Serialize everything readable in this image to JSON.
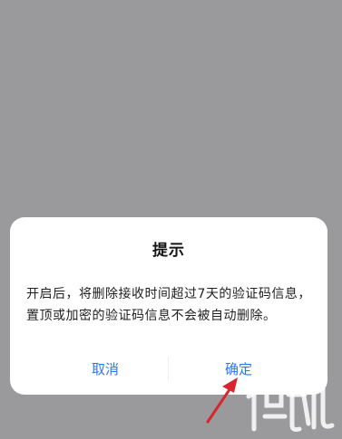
{
  "dialog": {
    "title": "提示",
    "message": "开启后，将删除接收时间超过7天的验证码信息，置顶或加密的验证码信息不会被自动删除。",
    "cancel_label": "取消",
    "confirm_label": "确定"
  },
  "annotation": {
    "arrow_color": "#d8262e"
  },
  "colors": {
    "scrim": "#9a999b",
    "dialog_bg": "#ffffff",
    "accent": "#2a78f0"
  }
}
